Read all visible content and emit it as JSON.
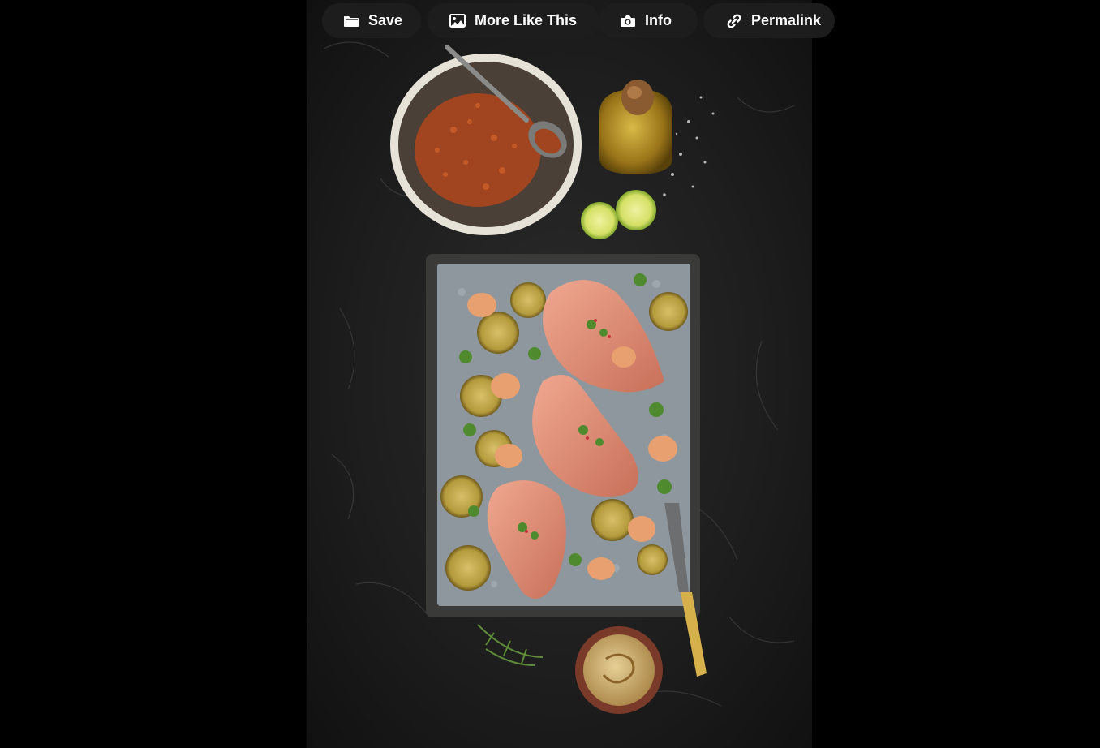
{
  "toolbar": {
    "save_label": "Save",
    "more_like_this_label": "More Like This",
    "info_label": "Info",
    "permalink_label": "Permalink"
  },
  "icons": {
    "save": "folder-icon",
    "more_like_this": "image-icon",
    "info": "camera-icon",
    "permalink": "link-icon"
  },
  "colors": {
    "page_background": "#000000",
    "toolbar_pill": "#1e1e1e",
    "toolbar_text": "#ffffff"
  }
}
